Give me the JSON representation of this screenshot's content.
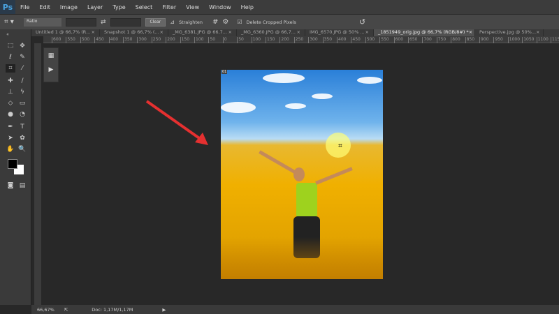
{
  "app": {
    "logo": "Ps"
  },
  "menu": [
    "File",
    "Edit",
    "Image",
    "Layer",
    "Type",
    "Select",
    "Filter",
    "View",
    "Window",
    "Help"
  ],
  "options": {
    "ratio": "Ratio",
    "clear": "Clear",
    "straighten": "Straighten",
    "delete_cropped": "Delete Cropped Pixels",
    "delete_cropped_checked": true
  },
  "tabs": [
    {
      "label": "Untitled 1 @ 66,7% (R...",
      "active": false
    },
    {
      "label": "Snapshot 1 @ 66,7% (...",
      "active": false
    },
    {
      "label": "_MG_6381.JPG @ 66,7...",
      "active": false
    },
    {
      "label": "_MG_6360.JPG @ 66,7...",
      "active": false
    },
    {
      "label": "IMG_6570.JPG @ 50% ...",
      "active": false
    },
    {
      "label": "_1851949_orig.jpg @ 66,7% (RGB/8#) *",
      "active": true
    },
    {
      "label": "Perspective.jpg @ 50%...",
      "active": false
    }
  ],
  "ruler": [
    "600",
    "550",
    "500",
    "450",
    "400",
    "350",
    "300",
    "250",
    "200",
    "150",
    "100",
    "50",
    "0",
    "50",
    "100",
    "150",
    "200",
    "250",
    "300",
    "350",
    "400",
    "450",
    "500",
    "550",
    "600",
    "650",
    "700",
    "750",
    "800",
    "850",
    "900",
    "950",
    "1000",
    "1050",
    "1100",
    "1150"
  ],
  "status": {
    "zoom": "66,67%",
    "doc": "Doc: 1,17M/1,17M"
  },
  "colors": {
    "arrow": "#e53030",
    "accent": "#4aa3e0"
  }
}
